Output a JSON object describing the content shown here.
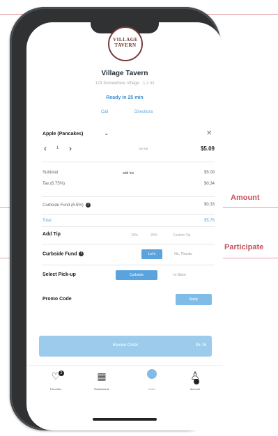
{
  "store": {
    "logo_line1": "VILLAGE",
    "logo_line2": "TAVERN",
    "logo_line3": "· · ·",
    "name": "Village Tavern",
    "address": "123 Somewhere Village · 1.2 mi",
    "ready": "Ready in 25 min",
    "link_left": "Call",
    "link_right": "Directions"
  },
  "order_item": {
    "name": "Apple (Pancakes)",
    "quantity": "1",
    "note": "no ice",
    "price": "$5.09"
  },
  "summary": {
    "subtotal_label": "Subtotal",
    "subtotal_mid": "add ins",
    "subtotal_value": "$5.09",
    "tax_label": "Tax (6.75%)",
    "tax_value": "$0.34",
    "curbside_label": "Curbside Fund (6.5%)",
    "curbside_value": "$0.33",
    "total_label": "Total",
    "total_value": "$5.76"
  },
  "tip": {
    "label": "Add Tip",
    "options": [
      "15%",
      "20%",
      "Custom Tip"
    ]
  },
  "curbside_fund": {
    "label": "Curbside Fund",
    "active_option": "Let's",
    "inactive_option": "No, Thanks"
  },
  "pickup": {
    "label": "Select Pick-up",
    "active_option": "Curbside",
    "inactive_option": "In-Store"
  },
  "promo": {
    "label": "Promo Code",
    "button": "Apply"
  },
  "cart": {
    "button_label": "Review Order",
    "total": "$5.76"
  },
  "tabs": [
    {
      "label": "Favorites",
      "badge": "2"
    },
    {
      "label": "Restaurants"
    },
    {
      "label": "Order"
    },
    {
      "label": "Account"
    }
  ],
  "annotations": {
    "amount": "Amount",
    "participate": "Participate"
  },
  "colors": {
    "accent": "#5aa3dd",
    "annotation": "#c9505a",
    "phone_frame": "#2f3133"
  }
}
